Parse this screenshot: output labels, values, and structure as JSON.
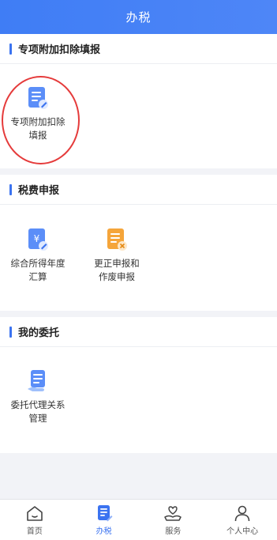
{
  "header": {
    "title": "办税"
  },
  "sections": [
    {
      "title": "专项附加扣除填报",
      "items": [
        {
          "label": "专项附加扣除\n填报",
          "icon": "doc-edit-icon"
        }
      ]
    },
    {
      "title": "税费申报",
      "items": [
        {
          "label": "综合所得年度\n汇算",
          "icon": "yuan-doc-icon"
        },
        {
          "label": "更正申报和\n作废申报",
          "icon": "doc-cancel-icon"
        }
      ]
    },
    {
      "title": "我的委托",
      "items": [
        {
          "label": "委托代理关系\n管理",
          "icon": "doc-hand-icon"
        }
      ]
    }
  ],
  "tabs": [
    {
      "label": "首页",
      "icon": "home-icon",
      "active": false
    },
    {
      "label": "办税",
      "icon": "tax-doc-icon",
      "active": true
    },
    {
      "label": "服务",
      "icon": "heart-hand-icon",
      "active": false
    },
    {
      "label": "个人中心",
      "icon": "person-icon",
      "active": false
    }
  ],
  "colors": {
    "primary": "#3b73f0",
    "highlight": "#e53b3b",
    "orange": "#f5a53a"
  }
}
